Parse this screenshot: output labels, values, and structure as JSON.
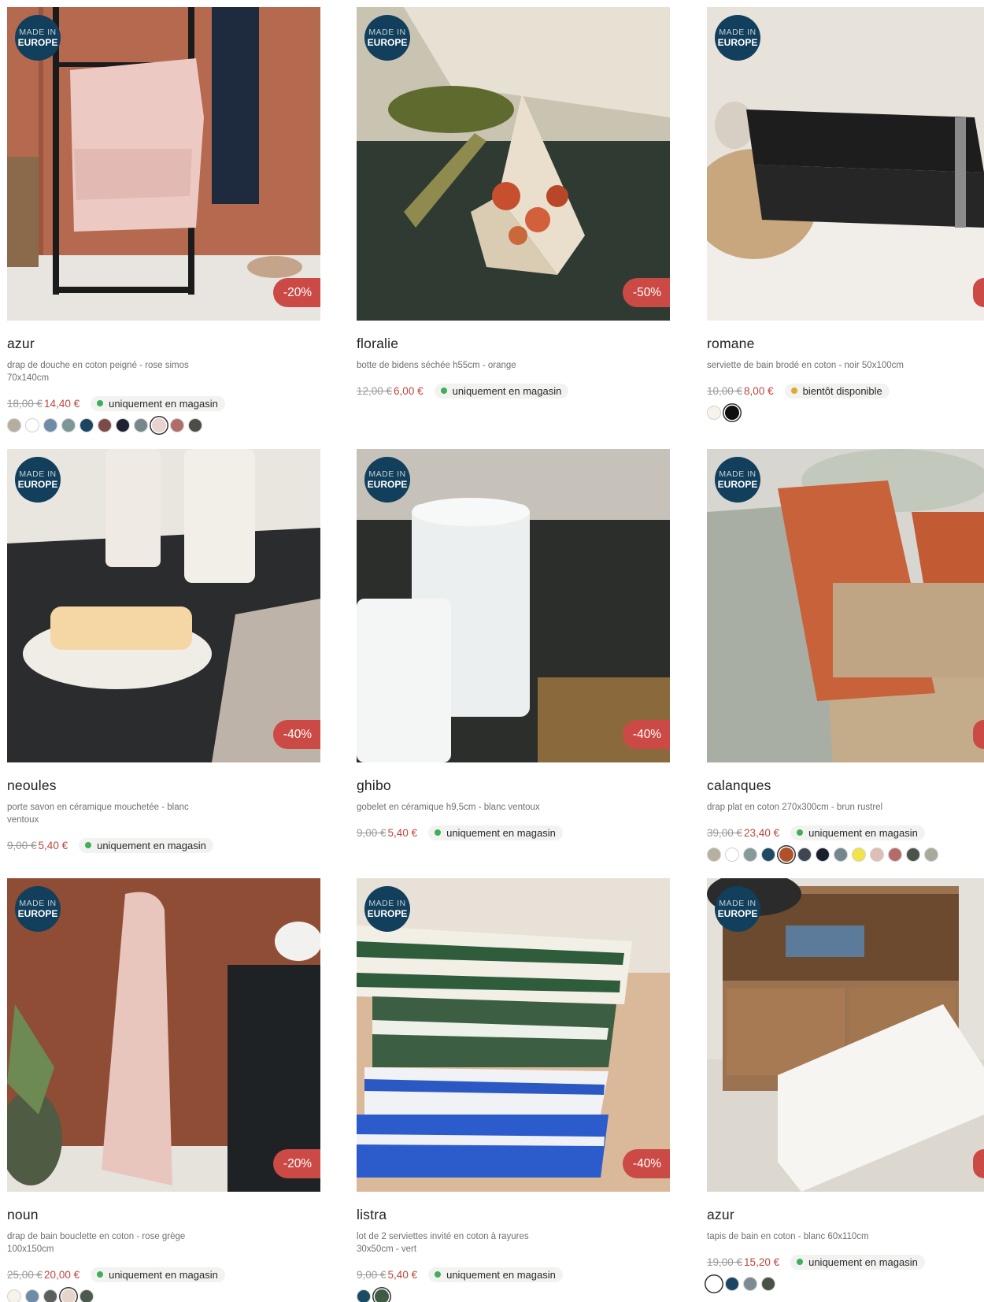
{
  "made_in": {
    "line1": "MADE IN",
    "line2": "EUROPE"
  },
  "colors": {
    "discount_bg": "#cb4a45",
    "sale_price": "#c0463f",
    "badge_bg": "#123f5c",
    "in_store_dot": "#3fae5a",
    "soon_dot": "#e1a92a"
  },
  "products": [
    {
      "name": "azur",
      "desc": "drap de douche en coton peigné - rose simos 70x140cm",
      "old_price": "18,00 €",
      "new_price": "14,40 €",
      "discount": "-20%",
      "stock": "uniquement en magasin",
      "stock_color": "#3fae5a",
      "swatches": [
        "#b5ad9d",
        "#ffffff",
        "#6e8ca8",
        "#7d9696",
        "#1b4560",
        "#7d4b47",
        "#1c2233",
        "#77868a",
        "#e9d3cf",
        "#b06d67",
        "#4b4e47"
      ],
      "selected_swatch": 8
    },
    {
      "name": "floralie",
      "desc": "botte de bidens séchée h55cm - orange",
      "old_price": "12,00 €",
      "new_price": "6,00 €",
      "discount": "-50%",
      "stock": "uniquement en magasin",
      "stock_color": "#3fae5a",
      "swatches": []
    },
    {
      "name": "romane",
      "desc": "serviette de bain brodé en coton - noir 50x100cm",
      "old_price": "10,00 €",
      "new_price": "8,00 €",
      "discount": "",
      "stock": "bientôt disponible",
      "stock_color": "#e1a92a",
      "swatches": [
        "#f7f3ea",
        "#0e0e0e"
      ],
      "selected_swatch": 1
    },
    {
      "name": "neoules",
      "desc": "porte savon en céramique mouchetée - blanc ventoux",
      "old_price": "9,00 €",
      "new_price": "5,40 €",
      "discount": "-40%",
      "stock": "uniquement en magasin",
      "stock_color": "#3fae5a",
      "swatches": []
    },
    {
      "name": "ghibo",
      "desc": "gobelet en céramique h9,5cm - blanc ventoux",
      "old_price": "9,00 €",
      "new_price": "5,40 €",
      "discount": "-40%",
      "stock": "uniquement en magasin",
      "stock_color": "#3fae5a",
      "swatches": []
    },
    {
      "name": "calanques",
      "desc": "drap plat en coton 270x300cm - brun rustrel",
      "old_price": "39,00 €",
      "new_price": "23,40 €",
      "discount": "",
      "stock": "uniquement en magasin",
      "stock_color": "#3fae5a",
      "swatches": [
        "#b6b09f",
        "#ffffff",
        "#869a9a",
        "#1d4b64",
        "#b0512a",
        "#3f4652",
        "#1a1f2e",
        "#76868d",
        "#f2e34a",
        "#dcc0b6",
        "#b56b68",
        "#4c5349",
        "#a7ab9b"
      ],
      "selected_swatch": 4
    },
    {
      "name": "noun",
      "desc": "drap de bain bouclette en coton - rose grège 100x150cm",
      "old_price": "25,00 €",
      "new_price": "20,00 €",
      "discount": "-20%",
      "stock": "uniquement en magasin",
      "stock_color": "#3fae5a",
      "swatches": [
        "#f7f3ea",
        "#6e8ca8",
        "#5d5f5f",
        "#e6d3c9",
        "#4b5a4f"
      ],
      "selected_swatch": 3
    },
    {
      "name": "listra",
      "desc": "lot de 2 serviettes invité en coton à rayures 30x50cm - vert",
      "old_price": "9,00 €",
      "new_price": "5,40 €",
      "discount": "-40%",
      "stock": "uniquement en magasin",
      "stock_color": "#3fae5a",
      "swatches": [
        "#1b4a63",
        "#3f5a45"
      ],
      "selected_swatch": 1
    },
    {
      "name": "azur",
      "desc": "tapis de bain en coton - blanc 60x110cm",
      "old_price": "19,00 €",
      "new_price": "15,20 €",
      "discount": "",
      "stock": "uniquement en magasin",
      "stock_color": "#3fae5a",
      "swatches": [
        "#ffffff",
        "#1b4560",
        "#7d8c92",
        "#4a5149"
      ],
      "selected_swatch": 0
    }
  ]
}
